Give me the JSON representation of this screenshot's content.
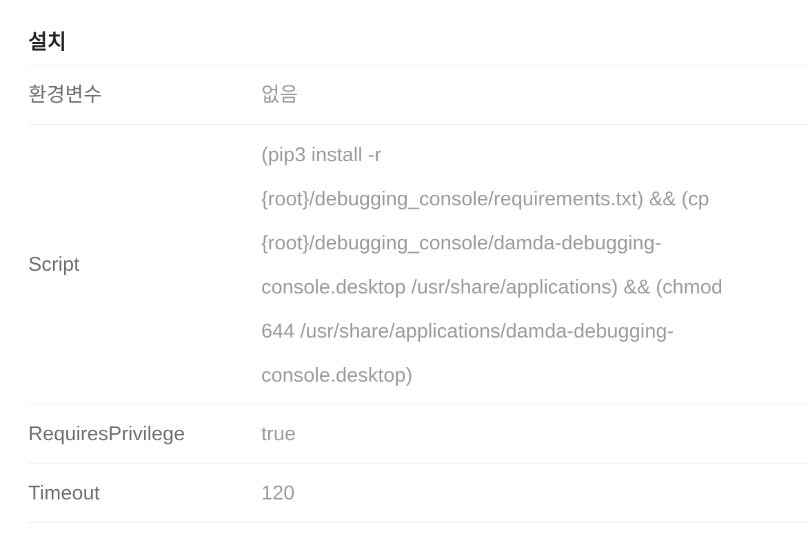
{
  "section": {
    "title": "설치"
  },
  "rows": [
    {
      "label": "환경변수",
      "value": "없음"
    },
    {
      "label": "Script",
      "value_lines": [
        "(pip3 install -r",
        "{root}/debugging_console/requirements.txt) && (cp",
        "{root}/debugging_console/damda-debugging-",
        "console.desktop /usr/share/applications) && (chmod",
        "644 /usr/share/applications/damda-debugging-",
        "console.desktop)"
      ]
    },
    {
      "label": "RequiresPrivilege",
      "value": "true"
    },
    {
      "label": "Timeout",
      "value": "120"
    }
  ]
}
